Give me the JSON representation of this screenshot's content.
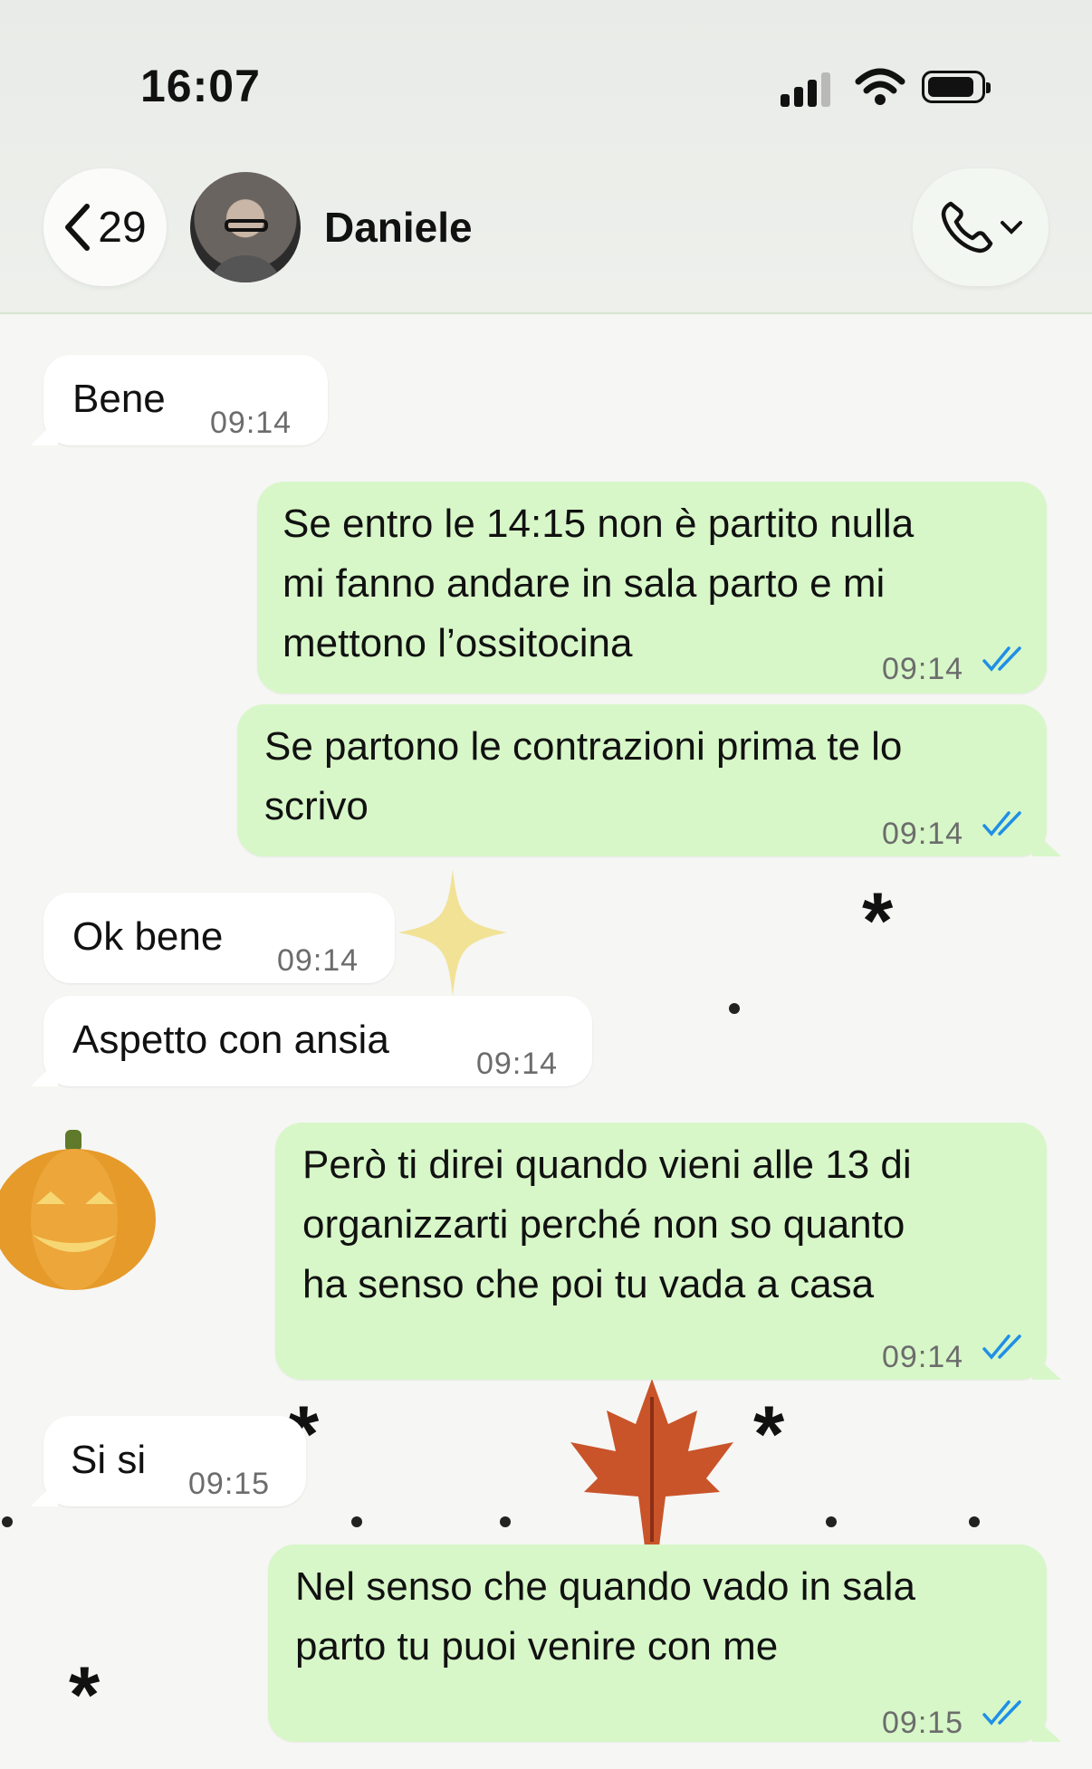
{
  "status_bar": {
    "time": "16:07"
  },
  "header": {
    "back_count": "29",
    "contact_name": "Daniele",
    "back_icon": "chevron-left-icon",
    "call_icon": "phone-icon",
    "menu_icon": "chevron-down-icon"
  },
  "messages": [
    {
      "direction": "in",
      "text": "Bene",
      "time": "09:14"
    },
    {
      "direction": "out",
      "text": "Se entro le 14:15 non è partito nulla\nmi fanno andare in sala parto e mi\nmettono l’ossitocina",
      "time": "09:14",
      "status": "read"
    },
    {
      "direction": "out",
      "text": "Se partono le contrazioni prima te lo\nscrivo",
      "time": "09:14",
      "status": "read"
    },
    {
      "direction": "in",
      "text": "Ok bene",
      "time": "09:14"
    },
    {
      "direction": "in",
      "text": "Aspetto con ansia",
      "time": "09:14"
    },
    {
      "direction": "out",
      "text": "Però ti direi quando vieni alle 13 di\norganizzarti perché non so quanto\nha senso che poi tu vada a casa",
      "time": "09:14",
      "status": "read"
    },
    {
      "direction": "in",
      "text": "Si si",
      "time": "09:15"
    },
    {
      "direction": "out",
      "text": "Nel senso che quando vado in sala\nparto tu puoi venire con me",
      "time": "09:15",
      "status": "read"
    }
  ],
  "colors": {
    "outgoing_bubble": "#d7f7c8",
    "incoming_bubble": "#ffffff",
    "read_ticks": "#1f8fe6"
  }
}
